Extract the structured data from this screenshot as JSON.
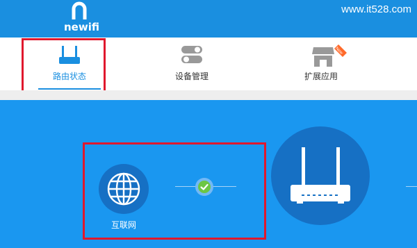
{
  "header": {
    "brand": "newifi",
    "watermark": "www.it528.com",
    "color": "#1a8fe0"
  },
  "nav": {
    "items": [
      {
        "label": "路由状态",
        "icon": "router-icon",
        "active": true
      },
      {
        "label": "设备管理",
        "icon": "toggle-switches-icon",
        "active": false
      },
      {
        "label": "扩展应用",
        "icon": "store-icon",
        "badge": "New",
        "active": false
      }
    ]
  },
  "main": {
    "internet": {
      "label": "互联网",
      "icon": "globe-icon",
      "connected": true
    },
    "status_icon": "check-icon",
    "router_icon": "router-icon",
    "colors": {
      "background": "#1a97f0",
      "circle": "#1670c4",
      "connected": "#6cc644",
      "highlight": "#e0182d"
    }
  }
}
